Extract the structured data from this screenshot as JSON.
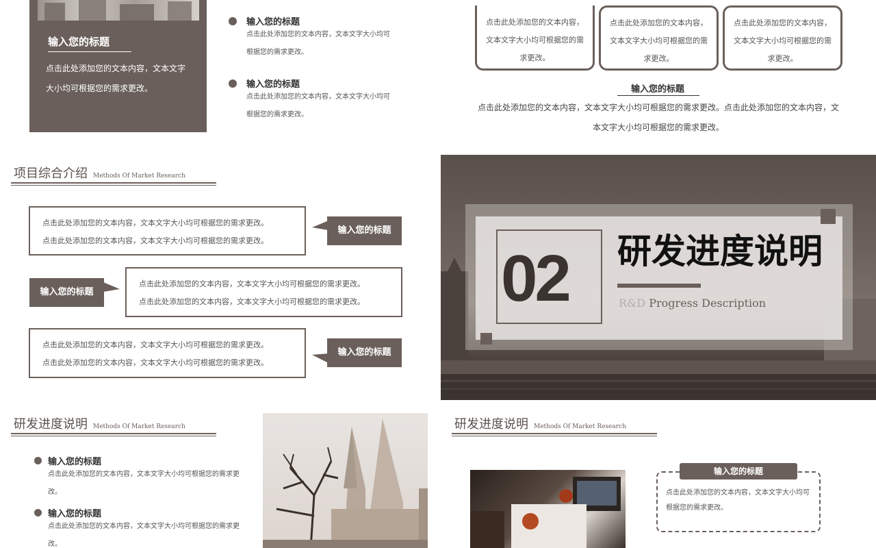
{
  "slide1": {
    "card_title": "输入您的标题",
    "card_body": "点击此处添加您的文本内容，文本文字大小均可根据您的需求更改。",
    "items": [
      {
        "title": "输入您的标题",
        "body": "点击此处添加您的文本内容，文本文字大小均可根据您的需求更改。"
      },
      {
        "title": "输入您的标题",
        "body": "点击此处添加您的文本内容，文本文字大小均可根据您的需求更改。"
      }
    ]
  },
  "slide2": {
    "boxes": [
      "点击此处添加您的文本内容，文本文字大小均可根据您的需求更改。",
      "点击此处添加您的文本内容，文本文字大小均可根据您的需求更改。",
      "点击此处添加您的文本内容，文本文字大小均可根据您的需求更改。"
    ],
    "title": "输入您的标题",
    "body": "点击此处添加您的文本内容，文本文字大小均可根据您的需求更改。点击此处添加您的文本内容，文本文字大小均可根据您的需求更改。"
  },
  "slide3": {
    "section_title": "项目综合介绍",
    "section_sub": "Methods Of Market Research",
    "rows": [
      {
        "line1": "点击此处添加您的文本内容，文本文字大小均可根据您的需求更改。",
        "line2": "点击此处添加您的文本内容，文本文字大小均可根据您的需求更改。",
        "tag": "输入您的标题"
      },
      {
        "line1": "点击此处添加您的文本内容，文本文字大小均可根据您的需求更改。",
        "line2": "点击此处添加您的文本内容，文本文字大小均可根据您的需求更改。",
        "tag": "输入您的标题"
      },
      {
        "line1": "点击此处添加您的文本内容，文本文字大小均可根据您的需求更改。",
        "line2": "点击此处添加您的文本内容，文本文字大小均可根据您的需求更改。",
        "tag": "输入您的标题"
      }
    ]
  },
  "slide4": {
    "number": "02",
    "title": "研发进度说明",
    "subtitle_prefix": "R&D",
    "subtitle": "Progress  Description"
  },
  "slide5": {
    "section_title": "研发进度说明",
    "section_sub": "Methods Of Market Research",
    "items": [
      {
        "title": "输入您的标题",
        "body": "点击此处添加您的文本内容，文本文字大小均可根据您的需求更改。"
      },
      {
        "title": "输入您的标题",
        "body": "点击此处添加您的文本内容，文本文字大小均可根据您的需求更改。"
      }
    ]
  },
  "slide6": {
    "section_title": "研发进度说明",
    "section_sub": "Methods Of Market Research",
    "tag": "输入您的标题",
    "body": "点击此处添加您的文本内容，文本文字大小均可根据您的需求更改。"
  },
  "colors": {
    "accent": "#6a5f5a",
    "dark_bg": "#4a3f3a"
  },
  "icons": [
    "building-photo",
    "cathedral-photo",
    "city-river-photo",
    "castle-towers-photo",
    "desk-laptop-photo"
  ]
}
